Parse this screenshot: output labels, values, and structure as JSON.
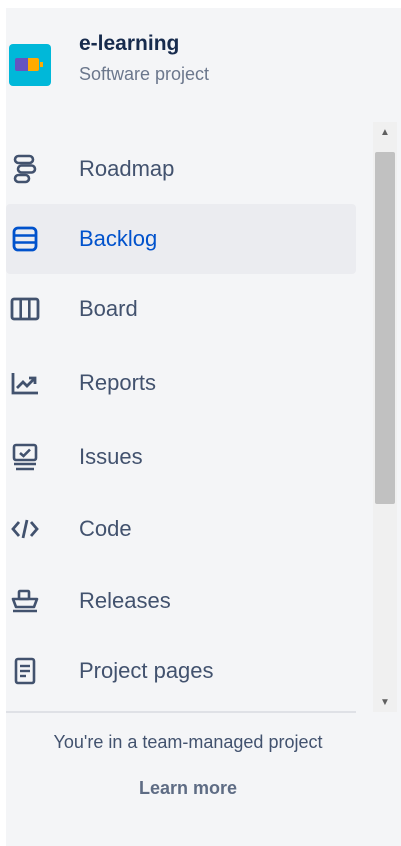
{
  "project": {
    "name": "e-learning",
    "type": "Software project"
  },
  "nav": {
    "items": [
      {
        "label": "Roadmap",
        "icon": "roadmap-icon",
        "active": false
      },
      {
        "label": "Backlog",
        "icon": "backlog-icon",
        "active": true
      },
      {
        "label": "Board",
        "icon": "board-icon",
        "active": false
      },
      {
        "label": "Reports",
        "icon": "reports-icon",
        "active": false
      },
      {
        "label": "Issues",
        "icon": "issues-icon",
        "active": false
      },
      {
        "label": "Code",
        "icon": "code-icon",
        "active": false
      },
      {
        "label": "Releases",
        "icon": "releases-icon",
        "active": false
      },
      {
        "label": "Project pages",
        "icon": "project-pages-icon",
        "active": false
      }
    ]
  },
  "footer": {
    "text": "You're in a team-managed project",
    "learn_more": "Learn more"
  },
  "colors": {
    "active_text": "#0052cc",
    "text": "#42526e",
    "active_bg": "#ebecf0",
    "sidebar_bg": "#f4f5f7"
  }
}
